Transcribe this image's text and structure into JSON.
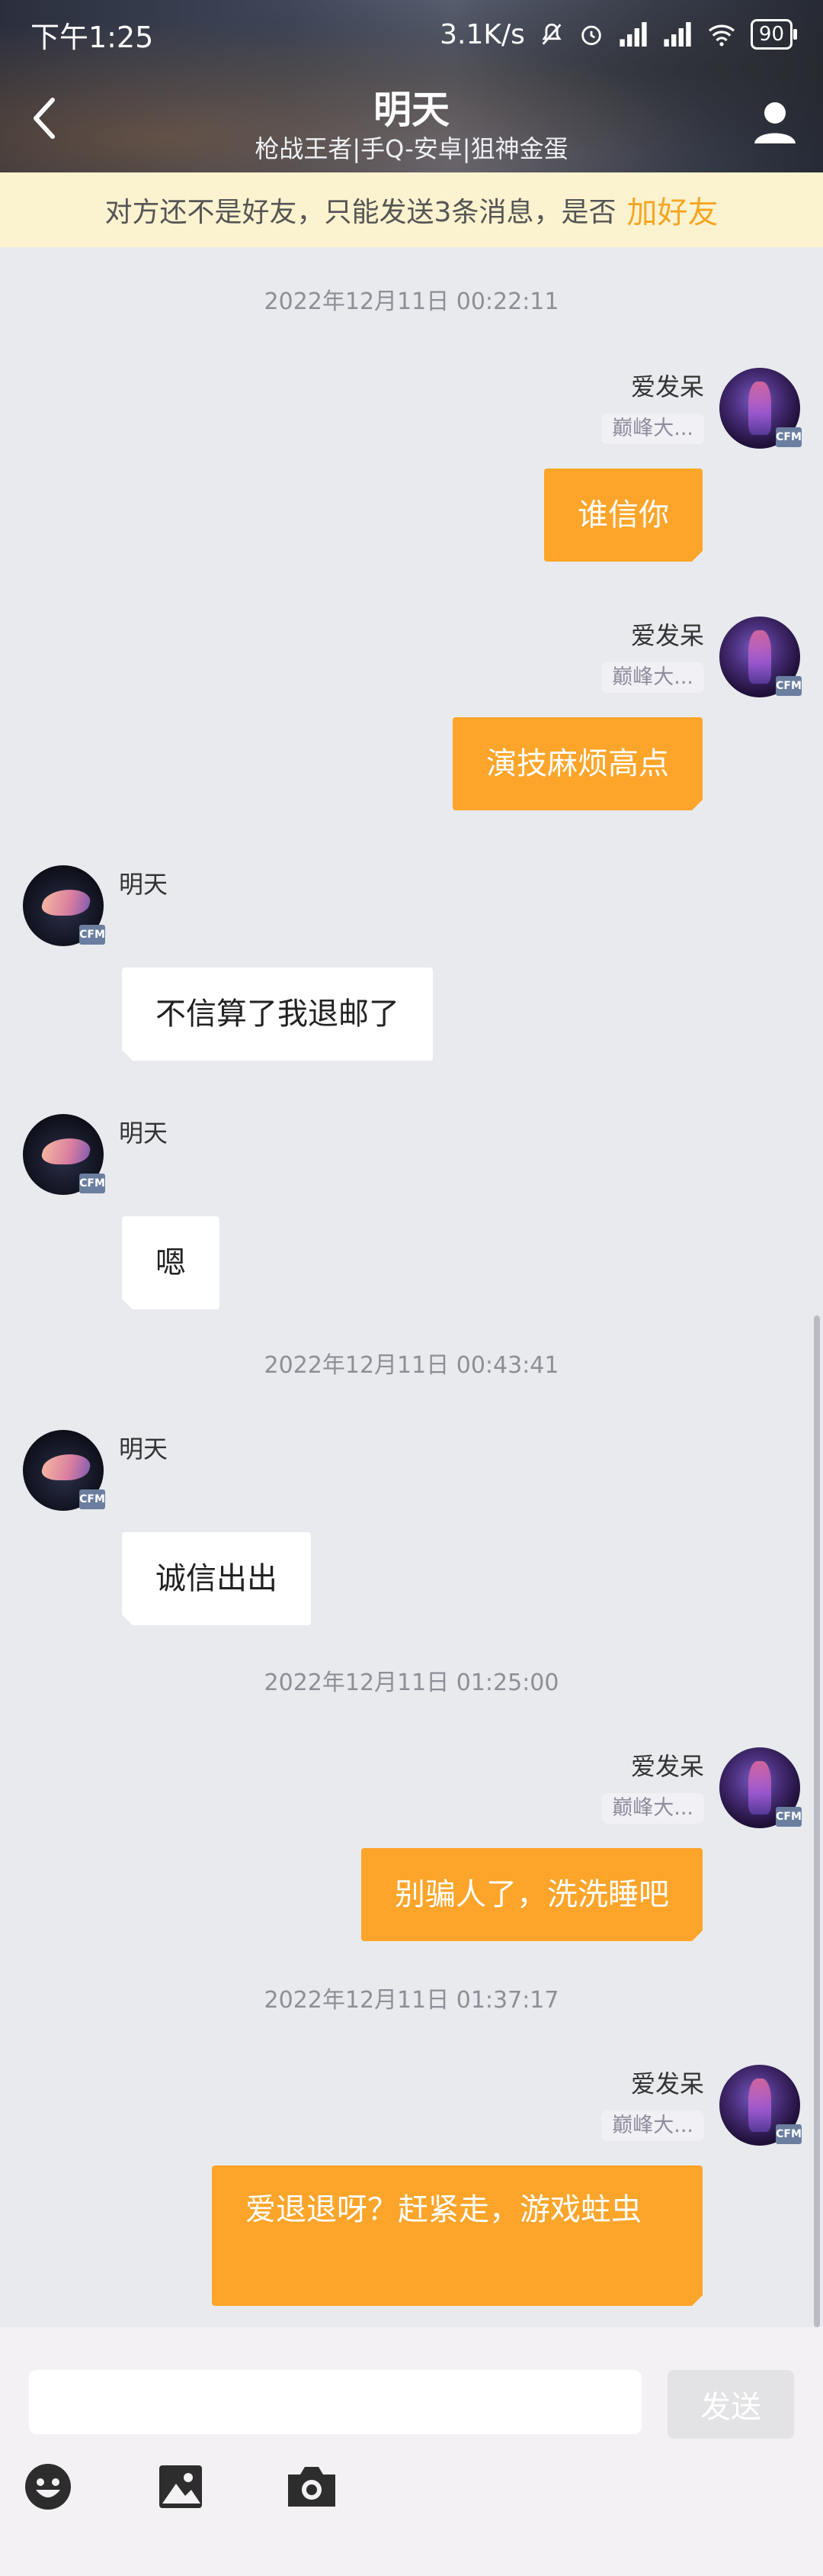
{
  "status_bar": {
    "time": "下午1:25",
    "speed": "3.1K/s",
    "battery": "90"
  },
  "header": {
    "title": "明天",
    "subtitle": "枪战王者|手Q-安卓|狙神金蛋"
  },
  "banner": {
    "text": "对方还不是好友，只能发送3条消息，是否",
    "link": "加好友"
  },
  "avatar_badge": "CFM",
  "me": {
    "name": "爱发呆",
    "tag": "巅峰大..."
  },
  "other": {
    "name": "明天"
  },
  "timestamps": [
    "2022年12月11日 00:22:11",
    "2022年12月11日 00:43:41",
    "2022年12月11日 01:25:00",
    "2022年12月11日 01:37:17"
  ],
  "messages": [
    "谁信你",
    "演技麻烦高点",
    "不信算了我退邮了",
    "嗯",
    "诚信出出",
    "别骗人了，洗洗睡吧",
    "爱退退呀？赶紧走，游戏蛀虫"
  ],
  "input": {
    "placeholder": "",
    "send_label": "发送"
  },
  "icons": {
    "back": "back-arrow-icon",
    "profile": "profile-icon",
    "emoji": "emoji-icon",
    "image": "image-icon",
    "camera": "camera-icon"
  }
}
